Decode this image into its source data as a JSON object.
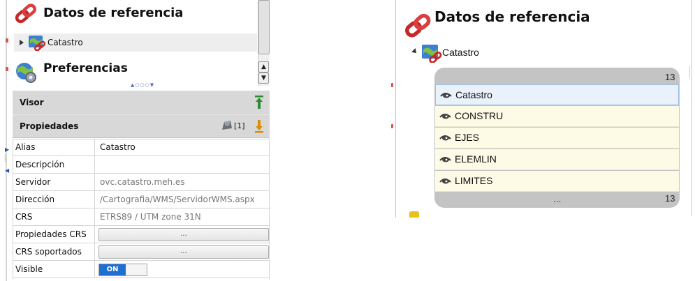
{
  "left": {
    "header_title": "Datos de referencia",
    "tree_item": "Catastro",
    "preferences_title": "Preferencias",
    "visor_label": "Visor",
    "props_label": "Propiedades",
    "props_count": "[1]",
    "rows": [
      {
        "key": "Alias",
        "value": "Catastro"
      },
      {
        "key": "Descripción",
        "value": ""
      },
      {
        "key": "Servidor",
        "value": "ovc.catastro.meh.es"
      },
      {
        "key": "Dirección",
        "value": "/Cartografia/WMS/ServidorWMS.aspx"
      },
      {
        "key": "CRS",
        "value": "ETRS89 / UTM zone 31N"
      },
      {
        "key": "Propiedades CRS",
        "value": "..."
      },
      {
        "key": "CRS soportados",
        "value": "..."
      },
      {
        "key": "Visible",
        "value": "ON"
      }
    ]
  },
  "right": {
    "header_title": "Datos de referencia",
    "tree_item": "Catastro",
    "count_top": "13",
    "count_bottom": "13",
    "ellipsis": "...",
    "layers": [
      {
        "name": "Catastro",
        "selected": true
      },
      {
        "name": "CONSTRU",
        "selected": false
      },
      {
        "name": "EJES",
        "selected": false
      },
      {
        "name": "ELEMLIN",
        "selected": false
      },
      {
        "name": "LIMITES",
        "selected": false
      }
    ]
  },
  "colors": {
    "accent_blue": "#1f6fd1",
    "link_red": "#c62828",
    "green_arrow": "#2e8b2e",
    "orange_arrow": "#d98e04"
  },
  "icons": [
    "link-icon",
    "globe-link-icon",
    "preferences-globe-icon",
    "green-up-arrow-icon",
    "orange-download-icon",
    "map-layer-icon",
    "eye-icon"
  ]
}
